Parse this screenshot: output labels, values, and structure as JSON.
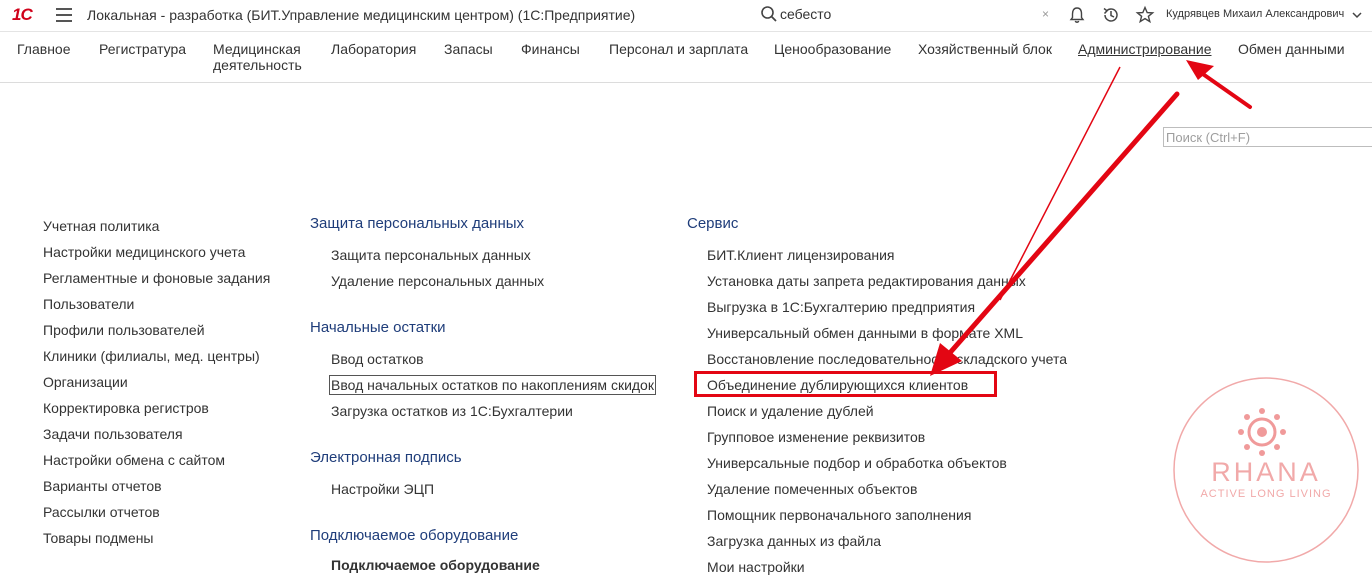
{
  "header": {
    "logo": "1С",
    "title": "Локальная - разработка (БИТ.Управление медицинским центром)  (1С:Предприятие)",
    "search_value": "себесто",
    "clear_label": "×",
    "user": "Кудрявцев Михаил Александрович"
  },
  "sections": [
    {
      "label": "Главное"
    },
    {
      "label": "Регистратура"
    },
    {
      "label": "Медицинская деятельность"
    },
    {
      "label": "Лаборатория"
    },
    {
      "label": "Запасы"
    },
    {
      "label": "Финансы"
    },
    {
      "label": "Персонал и зарплата"
    },
    {
      "label": "Ценообразование"
    },
    {
      "label": "Хозяйственный блок"
    },
    {
      "label": "Администрирование"
    },
    {
      "label": "Обмен данными"
    }
  ],
  "form_search": {
    "placeholder": "Поиск (Ctrl+F)"
  },
  "col1": {
    "items": [
      "Учетная политика",
      "Настройки медицинского учета",
      "Регламентные и фоновые задания",
      "Пользователи",
      "Профили пользователей",
      "Клиники (филиалы, мед. центры)",
      "Организации",
      "Корректировка регистров",
      "Задачи пользователя",
      "Настройки обмена с сайтом",
      "Варианты отчетов",
      "Рассылки отчетов",
      "Товары подмены"
    ]
  },
  "col2": {
    "groups": [
      {
        "title": "Защита персональных данных",
        "items": [
          "Защита персональных данных",
          "Удаление персональных данных"
        ]
      },
      {
        "title": "Начальные остатки",
        "items": [
          "Ввод остатков",
          "Ввод начальных остатков по накоплениям скидок",
          "Загрузка остатков из 1С:Бухгалтерии"
        ]
      },
      {
        "title": "Электронная подпись",
        "items": [
          "Настройки ЭЦП"
        ]
      },
      {
        "title": "Подключаемое оборудование",
        "items": [
          "Подключаемое оборудование"
        ]
      }
    ]
  },
  "col3": {
    "title": "Сервис",
    "items": [
      "БИТ.Клиент лицензирования",
      "Установка даты запрета редактирования данных",
      "Выгрузка в 1С:Бухгалтерию предприятия",
      "Универсальный обмен данными в формате XML",
      "Восстановление последовательности складского учета",
      "Объединение дублирующихся клиентов",
      "Поиск и удаление дублей",
      "Групповое изменение реквизитов",
      "Универсальные подбор и обработка объектов",
      "Удаление помеченных объектов",
      "Помощник первоначального заполнения",
      "Загрузка данных из файла",
      "Мои настройки"
    ]
  },
  "watermark": {
    "brand": "RHANA",
    "tagline": "ACTIVE LONG LIVING"
  },
  "colors": {
    "accent_red": "#e30613",
    "group_blue": "#1f3d7a",
    "watermark": "#f1a9a9"
  }
}
